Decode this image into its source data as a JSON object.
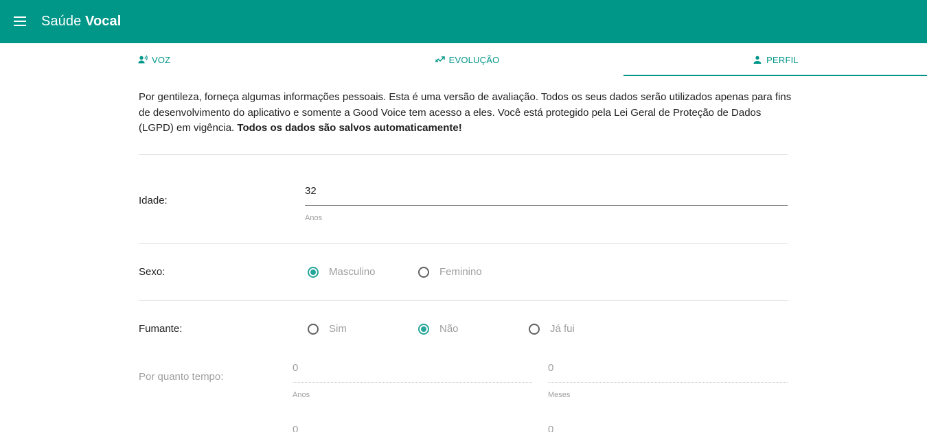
{
  "app": {
    "title_regular": "Saúde ",
    "title_bold": "Vocal"
  },
  "tabs": [
    {
      "label": "VOZ",
      "icon": "voice-icon"
    },
    {
      "label": "EVOLUÇÃO",
      "icon": "trending-icon"
    },
    {
      "label": "PERFIL",
      "icon": "person-icon",
      "active": true
    }
  ],
  "intro": {
    "text": "Por gentileza, forneça algumas informações pessoais. Esta é uma versão de avaliação. Todos os seus dados serão utilizados apenas para fins de desenvolvimento do aplicativo e somente a Good Voice tem acesso a eles. Você está protegido pela Lei Geral de Proteção de Dados (LGPD) em vigência. ",
    "bold": "Todos os dados são salvos automaticamente!"
  },
  "idade": {
    "label": "Idade:",
    "value": "32",
    "hint": "Anos"
  },
  "sexo": {
    "label": "Sexo:",
    "options": [
      {
        "label": "Masculino",
        "selected": true
      },
      {
        "label": "Feminino",
        "selected": false
      }
    ]
  },
  "fumante": {
    "label": "Fumante:",
    "options": [
      {
        "label": "Sim",
        "selected": false
      },
      {
        "label": "Não",
        "selected": true
      },
      {
        "label": "Já fui",
        "selected": false
      }
    ]
  },
  "tempo": {
    "label": "Por quanto tempo:",
    "anos": {
      "value": "0",
      "hint": "Anos"
    },
    "meses": {
      "value": "0",
      "hint": "Meses"
    },
    "row2_left": "0",
    "row2_right": "0"
  },
  "colors": {
    "primary": "#009688",
    "accent": "#26a69a"
  }
}
